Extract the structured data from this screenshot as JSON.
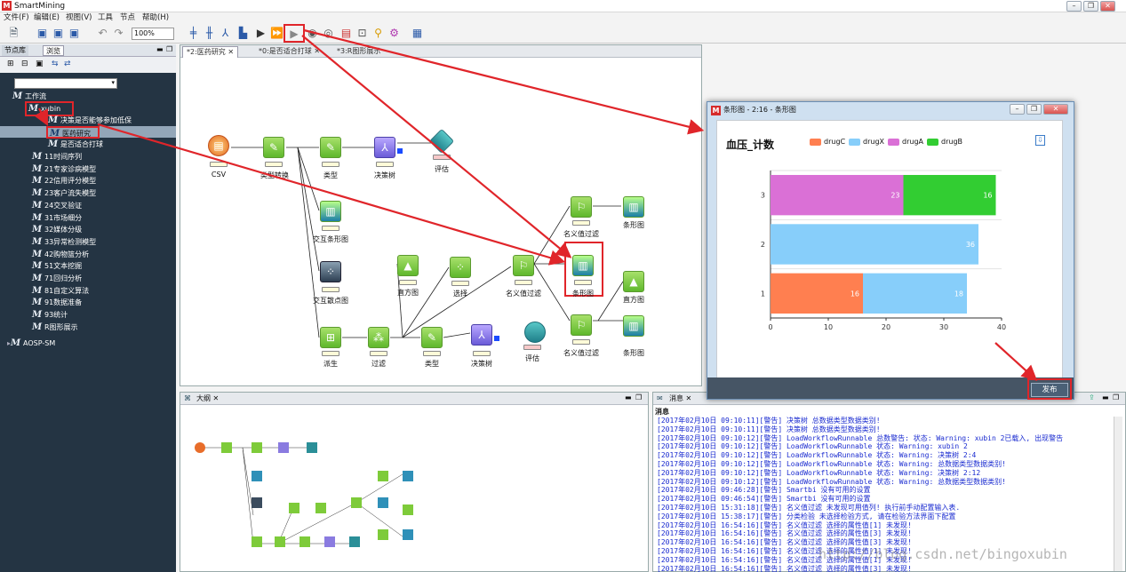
{
  "window": {
    "title": "SmartMining"
  },
  "menu": [
    "文件(F)",
    "编辑(E)",
    "视图(V)",
    "工具",
    "节点",
    "帮助(H)"
  ],
  "toolbar": {
    "zoom": "100%"
  },
  "left_panel": {
    "tabs": [
      "节点库",
      "浏览"
    ],
    "tree": {
      "root": "工作流",
      "xubin": "xubin",
      "xubin_children": [
        "决策是否能够参加低保",
        "医药研究",
        "是否适合打球"
      ],
      "items": [
        "11时间序列",
        "21专家诊病模型",
        "22信用评分模型",
        "23客户流失模型",
        "24交叉验证",
        "31市场细分",
        "32媒体分级",
        "33异常检测模型",
        "42购物篮分析",
        "51文本挖掘",
        "71回归分析",
        "81自定义算法",
        "91数据准备",
        "93统计",
        "R图形展示"
      ],
      "aosp": "AOSP-SM"
    }
  },
  "editor": {
    "tabs": [
      "*2:医药研究",
      "*0:是否适合打球",
      "*3:R图形展示"
    ],
    "nodes": {
      "csv": "CSV",
      "type_convert": "类型转换",
      "type1": "类型",
      "dtree1": "决策树",
      "eval1": "评估",
      "cross_bar": "交互条形图",
      "cross_scatter": "交互散点图",
      "derive": "派生",
      "filter": "过滤",
      "type2": "类型",
      "dtree2": "决策树",
      "eval2": "评估",
      "hist1": "直方图",
      "select": "选择",
      "nom_filter1": "名义值过滤",
      "bar_main": "条形图",
      "nom_filter_top": "名义值过滤",
      "bar_top": "条形图",
      "hist2": "直方图",
      "nom_filter_bot": "名义值过滤",
      "bar_bot": "条形图"
    }
  },
  "dialog": {
    "title": "条形图 - 2:16 - 条形图",
    "publish": "发布"
  },
  "chart_data": {
    "type": "bar",
    "orientation": "horizontal",
    "stacked": true,
    "title": "血压_计数",
    "categories": [
      "1",
      "2",
      "3"
    ],
    "series": [
      {
        "name": "drugC",
        "color": "#ff7f50",
        "values": [
          16,
          0,
          0
        ]
      },
      {
        "name": "drugX",
        "color": "#87cefa",
        "values": [
          18,
          36,
          0
        ]
      },
      {
        "name": "drugA",
        "color": "#da70d6",
        "values": [
          0,
          0,
          23
        ]
      },
      {
        "name": "drugB",
        "color": "#32cd32",
        "values": [
          0,
          0,
          16
        ]
      }
    ],
    "xlim": [
      0,
      40
    ],
    "xticks": [
      "0",
      "10",
      "20",
      "30",
      "40"
    ],
    "legend_position": "top"
  },
  "outline": {
    "tab": "大纲"
  },
  "log": {
    "tab": "消息",
    "header": "消息",
    "lines": [
      "[2017年02月10日 09:10:11][警告]  决策树                  总数据类型数据类别!",
      "[2017年02月10日 09:10:11][警告]  决策树                  总数据类型数据类别!",
      "[2017年02月10日 09:10:12][警告]  LoadWorkflowRunnable            总数警告: 状态: Warning: xubin 2已载入, 出现警告",
      "[2017年02月10日 09:10:12][警告]  LoadWorkflowRunnable            状态: Warning: xubin 2",
      "[2017年02月10日 09:10:12][警告]  LoadWorkflowRunnable            状态: Warning: 决策树 2:4",
      "[2017年02月10日 09:10:12][警告]  LoadWorkflowRunnable            状态: Warning: 总数据类型数据类别!",
      "[2017年02月10日 09:10:12][警告]  LoadWorkflowRunnable            状态: Warning: 决策树 2:12",
      "[2017年02月10日 09:10:12][警告]  LoadWorkflowRunnable            状态: Warning: 总数据类型数据类别!",
      "[2017年02月10日 09:46:28][警告]  Smartbi                         没有可用的设置",
      "[2017年02月10日 09:46:54][警告]  Smartbi                         没有可用的设置",
      "[2017年02月10日 15:31:18][警告]  名义值过滤              未发现可用值列! 执行前手动配置输入表.",
      "[2017年02月10日 15:38:17][警告]  分类检验                未选择检验方式, 请在检验方法界面下配置",
      "[2017年02月10日 16:54:16][警告]  名义值过滤              选择的属性值[1] 未发现!",
      "[2017年02月10日 16:54:16][警告]  名义值过滤              选择的属性值[3] 未发现!",
      "[2017年02月10日 16:54:16][警告]  名义值过滤              选择的属性值[3] 未发现!",
      "[2017年02月10日 16:54:16][警告]  名义值过滤              选择的属性值[1] 未发现!",
      "[2017年02月10日 16:54:16][警告]  名义值过滤              选择的属性值[1] 未发现!",
      "[2017年02月10日 16:54:16][警告]  名义值过滤              选择的属性值[3] 未发现!",
      "[2017年02月10日 16:54:16][警告]  名义值过滤              选择的属性值[3] 未发现!"
    ]
  },
  "watermark": "http://blog.csdn.net/bingoxubin"
}
